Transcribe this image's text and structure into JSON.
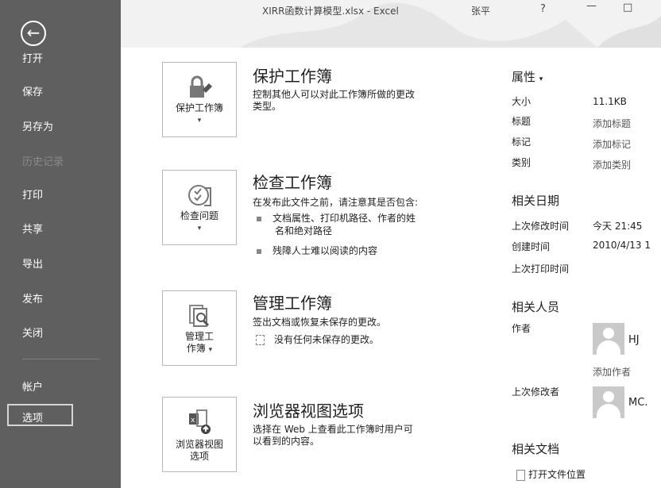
{
  "window": {
    "title": "XIRR函数计算模型.xlsx - Excel",
    "user": "张平",
    "help": "?",
    "minimize": "—",
    "maximize": "□"
  },
  "sidebar": {
    "back_glyph": "←",
    "items": [
      {
        "label": "打开"
      },
      {
        "label": "保存"
      },
      {
        "label": "另存为"
      },
      {
        "label": "历史记录"
      },
      {
        "label": "打印"
      },
      {
        "label": "共享"
      },
      {
        "label": "导出"
      },
      {
        "label": "发布"
      },
      {
        "label": "关闭"
      },
      {
        "label": "帐户"
      },
      {
        "label": "选项"
      }
    ]
  },
  "sections": {
    "protect": {
      "tile_label": "保护工作簿",
      "caret": "▾",
      "title": "保护工作簿",
      "desc1": "控制其他人可以对此工作簿所做的更改",
      "desc2": "类型。",
      "icon": "lock-icon"
    },
    "inspect": {
      "tile_label": "检查问题",
      "caret": "▾",
      "title": "检查工作簿",
      "desc": "在发布此文件之前，请注意其是否包含:",
      "b1a": "文档属性、打印机路径、作者的姓",
      "b1b": "名和绝对路径",
      "b2": "残障人士难以阅读的内容",
      "icon": "inspect-icon"
    },
    "manage": {
      "tile_label1": "管理工",
      "tile_label2": "作簿",
      "caret": "▾",
      "title": "管理工作簿",
      "desc": "签出文档或恢复未保存的更改。",
      "sub": "没有任何未保存的更改。",
      "icon": "manage-icon"
    },
    "browser": {
      "tile_label1": "浏览器视图",
      "tile_label2": "选项",
      "title": "浏览器视图选项",
      "desc1": "选择在 Web 上查看此工作簿时用户可",
      "desc2": "以看到的内容。",
      "icon": "browser-view-icon"
    }
  },
  "properties": {
    "header": "属性",
    "header_caret": "▾",
    "size_label": "大小",
    "size_value": "11.1KB",
    "title_label": "标题",
    "title_value": "添加标题",
    "tags_label": "标记",
    "tags_value": "添加标记",
    "category_label": "类别",
    "category_value": "添加类别",
    "dates_header": "相关日期",
    "modified_label": "上次修改时间",
    "modified_value": "今天 21:45",
    "created_label": "创建时间",
    "created_value": "2010/4/13 1",
    "printed_label": "上次打印时间",
    "people_header": "相关人员",
    "author_label": "作者",
    "author_name": "HJ",
    "add_author": "添加作者",
    "last_modified_by_label": "上次修改者",
    "last_modified_by_name": "MC.",
    "docs_header": "相关文档",
    "open_location": "打开文件位置"
  },
  "colors": {
    "sidebar_bg": "#5f5f5f",
    "selected_border": "#d6d6d6"
  }
}
